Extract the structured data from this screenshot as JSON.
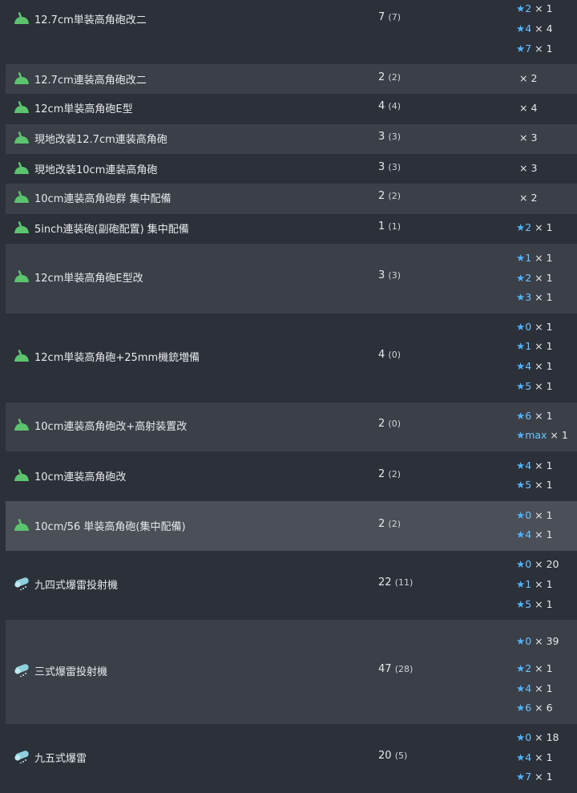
{
  "rows": [
    {
      "icon": "gun-icon",
      "name": "12.7cm単装高角砲改二",
      "count": "7",
      "parenthetical": "(7)",
      "stars": [
        {
          "level": "2",
          "qty": "1"
        },
        {
          "level": "4",
          "qty": "4"
        },
        {
          "level": "7",
          "qty": "1"
        }
      ]
    },
    {
      "icon": "gun-icon",
      "name": "12.7cm連装高角砲改二",
      "count": "2",
      "parenthetical": "(2)",
      "stars": [
        {
          "level": "",
          "qty": "2"
        }
      ]
    },
    {
      "icon": "gun-icon",
      "name": "12cm単装高角砲E型",
      "count": "4",
      "parenthetical": "(4)",
      "stars": [
        {
          "level": "",
          "qty": "4"
        }
      ]
    },
    {
      "icon": "gun-icon",
      "name": "現地改装12.7cm連装高角砲",
      "count": "3",
      "parenthetical": "(3)",
      "stars": [
        {
          "level": "",
          "qty": "3"
        }
      ]
    },
    {
      "icon": "gun-icon",
      "name": "現地改装10cm連装高角砲",
      "count": "3",
      "parenthetical": "(3)",
      "stars": [
        {
          "level": "",
          "qty": "3"
        }
      ]
    },
    {
      "icon": "gun-icon",
      "name": "10cm連装高角砲群 集中配備",
      "count": "2",
      "parenthetical": "(2)",
      "stars": [
        {
          "level": "",
          "qty": "2"
        }
      ]
    },
    {
      "icon": "gun-icon",
      "name": "5inch連装砲(副砲配置) 集中配備",
      "count": "1",
      "parenthetical": "(1)",
      "stars": [
        {
          "level": "2",
          "qty": "1"
        }
      ]
    },
    {
      "icon": "gun-icon",
      "name": "12cm単装高角砲E型改",
      "count": "3",
      "parenthetical": "(3)",
      "stars": [
        {
          "level": "1",
          "qty": "1"
        },
        {
          "level": "2",
          "qty": "1"
        },
        {
          "level": "3",
          "qty": "1"
        }
      ]
    },
    {
      "icon": "gun-icon",
      "name": "12cm単装高角砲+25mm機銃増備",
      "count": "4",
      "parenthetical": "(0)",
      "stars": [
        {
          "level": "0",
          "qty": "1"
        },
        {
          "level": "1",
          "qty": "1"
        },
        {
          "level": "4",
          "qty": "1"
        },
        {
          "level": "5",
          "qty": "1"
        }
      ]
    },
    {
      "icon": "gun-icon",
      "name": "10cm連装高角砲改+高射装置改",
      "count": "2",
      "parenthetical": "(0)",
      "stars": [
        {
          "level": "6",
          "qty": "1"
        },
        {
          "level": "max",
          "qty": "1"
        }
      ]
    },
    {
      "icon": "gun-icon",
      "name": "10cm連装高角砲改",
      "count": "2",
      "parenthetical": "(2)",
      "stars": [
        {
          "level": "4",
          "qty": "1"
        },
        {
          "level": "5",
          "qty": "1"
        }
      ]
    },
    {
      "icon": "gun-icon",
      "name": "10cm/56 単装高角砲(集中配備)",
      "count": "2",
      "parenthetical": "(2)",
      "stars": [
        {
          "level": "0",
          "qty": "1"
        },
        {
          "level": "4",
          "qty": "1"
        }
      ]
    },
    {
      "icon": "depth-charge-projector-icon",
      "name": "九四式爆雷投射機",
      "count": "22",
      "parenthetical": "(11)",
      "stars": [
        {
          "level": "0",
          "qty": "20"
        },
        {
          "level": "1",
          "qty": "1"
        },
        {
          "level": "5",
          "qty": "1"
        }
      ]
    },
    {
      "icon": "depth-charge-projector-icon",
      "name": "三式爆雷投射機",
      "count": "47",
      "parenthetical": "(28)",
      "stars": [
        {
          "level": "0",
          "qty": "39"
        },
        {
          "level": "2",
          "qty": "1"
        },
        {
          "level": "4",
          "qty": "1"
        },
        {
          "level": "6",
          "qty": "6"
        }
      ]
    },
    {
      "icon": "depth-charge-projector-icon",
      "name": "九五式爆雷",
      "count": "20",
      "parenthetical": "(5)",
      "stars": [
        {
          "level": "0",
          "qty": "18"
        },
        {
          "level": "4",
          "qty": "1"
        },
        {
          "level": "7",
          "qty": "1"
        }
      ]
    }
  ],
  "colors": {
    "star": "#4fb3ff",
    "gun_icon": "#5cc46e",
    "depth_charge_icon": "#8fd0dd"
  }
}
